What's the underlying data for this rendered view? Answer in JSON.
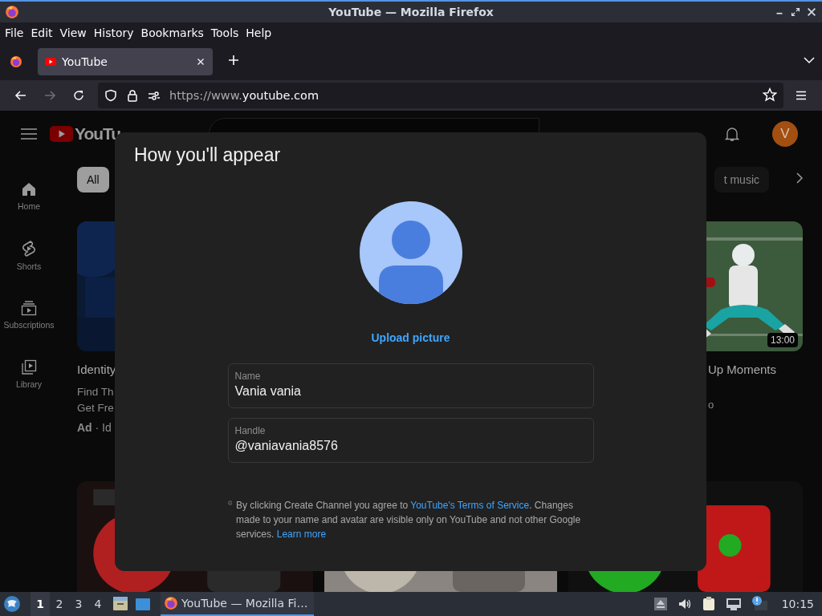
{
  "window": {
    "title": "YouTube — Mozilla Firefox"
  },
  "menu": [
    "File",
    "Edit",
    "View",
    "History",
    "Bookmarks",
    "Tools",
    "Help"
  ],
  "tabs": [
    {
      "label": "YouTube",
      "selected": true
    }
  ],
  "address_bar": {
    "url_prefix": "https://www.",
    "url_domain": "youtube.com"
  },
  "youtube": {
    "logo_text": "YouTu",
    "avatar_letter": "V",
    "sidebar": [
      {
        "kind": "home",
        "label": "Home"
      },
      {
        "kind": "shorts",
        "label": "Shorts"
      },
      {
        "kind": "subscriptions",
        "label": "Subscriptions"
      },
      {
        "kind": "library",
        "label": "Library"
      }
    ],
    "chips": [
      {
        "label": "All",
        "selected": true
      },
      {
        "label": "t music",
        "selected": false
      }
    ],
    "videos": [
      {
        "title": "Identity",
        "description": [
          "Find Th",
          "Get Fre"
        ],
        "meta": "**Ad** · Id"
      },
      {
        "title": "Up Moments",
        "meta": "o",
        "duration": "13:00"
      }
    ]
  },
  "dialog": {
    "title": "How you'll appear",
    "upload": "Upload picture",
    "fields": [
      {
        "label": "Name",
        "value": "Vania vania"
      },
      {
        "label": "Handle",
        "value": "@vaniavania8576"
      }
    ],
    "notice": {
      "before": "By clicking Create Channel you agree to ",
      "link": "YouTube's Terms of Service",
      "after": ". Changes made to your name and avatar are visible only on YouTube and not other Google services. ",
      "learn_more": "Learn more"
    }
  },
  "taskbar": {
    "workspaces": [
      {
        "label": "1",
        "selected": true
      },
      {
        "label": "2",
        "selected": false
      },
      {
        "label": "3",
        "selected": false
      },
      {
        "label": "4",
        "selected": false
      }
    ],
    "window_button": {
      "label": "YouTube — Mozilla Fi…",
      "selected": true
    },
    "clock": "10:15"
  }
}
